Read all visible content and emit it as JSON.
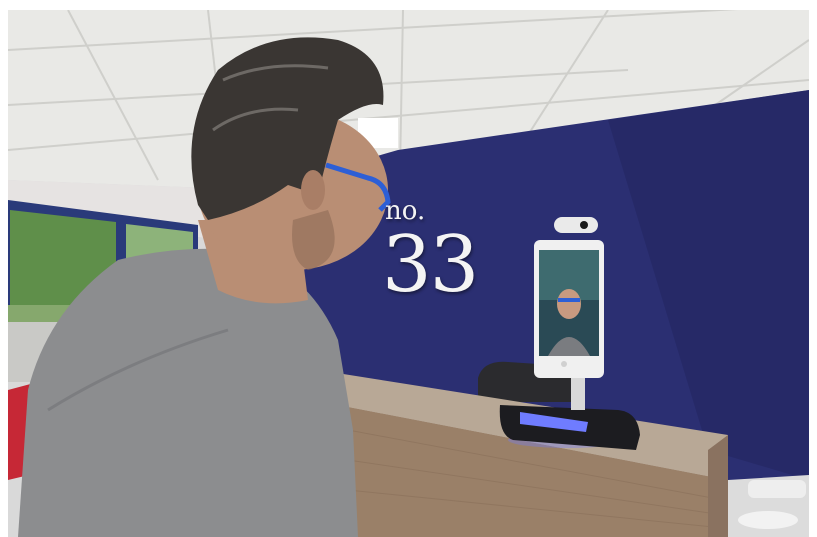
{
  "photo": {
    "description_alt": "",
    "wall_sign": {
      "prefix": "no.",
      "number": "33"
    },
    "kiosk_screen_message": ""
  },
  "colors": {
    "wall": "#2b2f72",
    "ceiling": "#e9e9e6",
    "desk_top": "#b8a896",
    "desk_front": "#9a8068",
    "sweater": "#8c8d8f",
    "hair": "#3a3633",
    "skin": "#b98e74",
    "glasses": "#2d5fd6",
    "kiosk_frame": "#f0f0f0",
    "kiosk_base_light": "#6f7cff"
  }
}
